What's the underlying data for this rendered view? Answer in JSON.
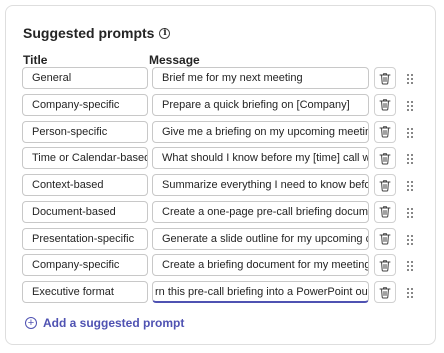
{
  "section": {
    "title": "Suggested prompts",
    "info_icon": "info-icon"
  },
  "columns": {
    "title": "Title",
    "message": "Message"
  },
  "prompts": [
    {
      "title": "General",
      "message": "Brief me for my next meeting"
    },
    {
      "title": "Company-specific",
      "message": "Prepare a quick briefing on [Company]"
    },
    {
      "title": "Person-specific",
      "message": "Give me a briefing on my upcoming meeting wit"
    },
    {
      "title": "Time or Calendar-based",
      "message": "What should I know before my [time] call with [C"
    },
    {
      "title": "Context-based",
      "message": "Summarize everything I need to know before tal"
    },
    {
      "title": "Document-based",
      "message": "Create a one-page pre-call briefing document fo"
    },
    {
      "title": "Presentation-specific",
      "message": "Generate a slide outline for my upcoming custor"
    },
    {
      "title": "Company-specific",
      "message": "Create a briefing document for my meeting with"
    },
    {
      "title": "Executive format",
      "message": "rn this pre-call briefing into a PowerPoint outline"
    }
  ],
  "add_button": {
    "label": "Add a suggested prompt"
  },
  "icons": {
    "delete": "trash-icon",
    "drag": "drag-handle-icon",
    "add": "add-circle-icon"
  },
  "colors": {
    "accent": "#4f52b2",
    "border": "#c8c8c8",
    "text": "#242424"
  }
}
